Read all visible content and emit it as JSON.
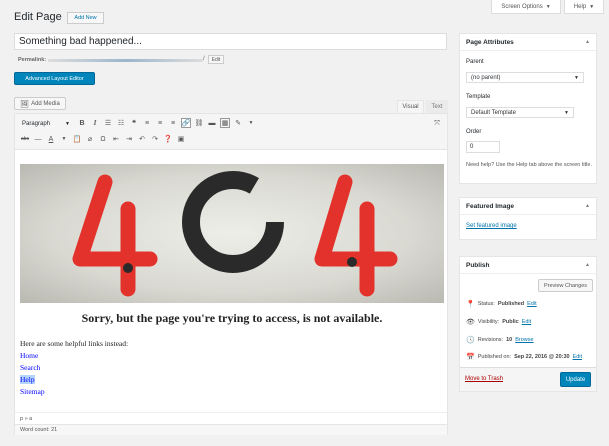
{
  "screen_options": "Screen Options",
  "help": "Help",
  "page_title": "Edit Page",
  "add_new": "Add New",
  "post_title": "Something bad happened...",
  "permalink_label": "Permalink:",
  "permalink_tail": "/",
  "permalink_edit": "Edit",
  "advanced_editor": "Advanced Layout Editor",
  "add_media": "Add Media",
  "tab_visual": "Visual",
  "tab_text": "Text",
  "format_select": "Paragraph",
  "image_text": "404",
  "heading": "Sorry, but the page you're trying to access, is not available.",
  "helpful": "Here are some helpful links instead:",
  "links": [
    "Home",
    "Search",
    "Help",
    "Sitemap"
  ],
  "path": "p » a",
  "word_count": "Word count: 21",
  "page_attributes": {
    "title": "Page Attributes",
    "parent_label": "Parent",
    "parent_value": "(no parent)",
    "template_label": "Template",
    "template_value": "Default Template",
    "order_label": "Order",
    "order_value": "0",
    "help_text": "Need help? Use the Help tab above the screen title."
  },
  "featured": {
    "title": "Featured Image",
    "link": "Set featured image"
  },
  "publish": {
    "title": "Publish",
    "preview": "Preview Changes",
    "status_label": "Status:",
    "status_value": "Published",
    "status_edit": "Edit",
    "vis_label": "Visibility:",
    "vis_value": "Public",
    "vis_edit": "Edit",
    "rev_label": "Revisions:",
    "rev_value": "10",
    "rev_link": "Browse",
    "pub_label": "Published on:",
    "pub_value": "Sep 22, 2016 @ 20:30",
    "pub_edit": "Edit",
    "trash": "Move to Trash",
    "update": "Update"
  },
  "colors": {
    "accent": "#0073aa",
    "button_blue": "#0085ba",
    "trash": "#a00",
    "image_red": "#e3322b"
  }
}
